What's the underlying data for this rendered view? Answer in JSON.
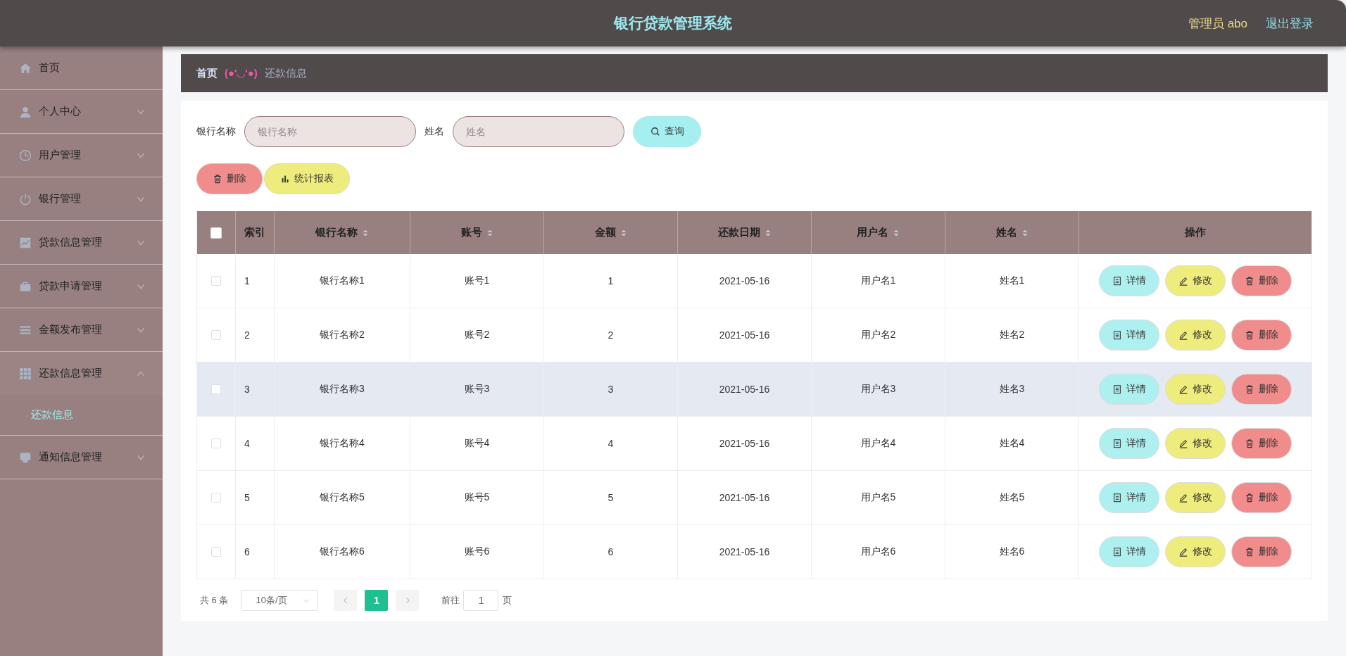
{
  "header": {
    "title": "银行贷款管理系统",
    "user": "管理员 abo",
    "logout": "退出登录"
  },
  "sidebar": {
    "items": [
      {
        "label": "首页"
      },
      {
        "label": "个人中心",
        "expanded": false
      },
      {
        "label": "用户管理",
        "expanded": false
      },
      {
        "label": "银行管理",
        "expanded": false
      },
      {
        "label": "贷款信息管理",
        "expanded": false
      },
      {
        "label": "贷款申请管理",
        "expanded": false
      },
      {
        "label": "金额发布管理",
        "expanded": false
      },
      {
        "label": "还款信息管理",
        "expanded": true,
        "children": [
          {
            "label": "还款信息",
            "selected": true
          }
        ]
      },
      {
        "label": "通知信息管理",
        "expanded": false
      }
    ]
  },
  "breadcrumb": {
    "home": "首页",
    "separator": "(●'◡'●)",
    "current": "还款信息"
  },
  "search": {
    "fields": [
      {
        "label": "银行名称",
        "placeholder": "银行名称"
      },
      {
        "label": "姓名",
        "placeholder": "姓名"
      }
    ],
    "button": "查询"
  },
  "actions": [
    {
      "kind": "delete",
      "label": "删除"
    },
    {
      "kind": "report",
      "label": "统计报表"
    }
  ],
  "table": {
    "select_all": {
      "checked": false
    },
    "columns": [
      {
        "label": "索引",
        "sortable": false
      },
      {
        "label": "银行名称",
        "sortable": true
      },
      {
        "label": "账号",
        "sortable": true
      },
      {
        "label": "金额",
        "sortable": true
      },
      {
        "label": "还款日期",
        "sortable": true
      },
      {
        "label": "用户名",
        "sortable": true
      },
      {
        "label": "姓名",
        "sortable": true
      },
      {
        "label": "操作",
        "sortable": false
      }
    ],
    "rows": [
      {
        "checked": false,
        "highlighted": false,
        "cells": [
          "1",
          "银行名称1",
          "账号1",
          "1",
          "2021-05-16",
          "用户名1",
          "姓名1"
        ],
        "buttons": [
          {
            "kind": "detail",
            "label": "详情"
          },
          {
            "kind": "edit",
            "label": "修改"
          },
          {
            "kind": "delete",
            "label": "删除"
          }
        ]
      },
      {
        "checked": false,
        "highlighted": false,
        "cells": [
          "2",
          "银行名称2",
          "账号2",
          "2",
          "2021-05-16",
          "用户名2",
          "姓名2"
        ],
        "buttons": [
          {
            "kind": "detail",
            "label": "详情"
          },
          {
            "kind": "edit",
            "label": "修改"
          },
          {
            "kind": "delete",
            "label": "删除"
          }
        ]
      },
      {
        "checked": false,
        "highlighted": true,
        "cells": [
          "3",
          "银行名称3",
          "账号3",
          "3",
          "2021-05-16",
          "用户名3",
          "姓名3"
        ],
        "buttons": [
          {
            "kind": "detail",
            "label": "详情"
          },
          {
            "kind": "edit",
            "label": "修改"
          },
          {
            "kind": "delete",
            "label": "删除"
          }
        ]
      },
      {
        "checked": false,
        "highlighted": false,
        "cells": [
          "4",
          "银行名称4",
          "账号4",
          "4",
          "2021-05-16",
          "用户名4",
          "姓名4"
        ],
        "buttons": [
          {
            "kind": "detail",
            "label": "详情"
          },
          {
            "kind": "edit",
            "label": "修改"
          },
          {
            "kind": "delete",
            "label": "删除"
          }
        ]
      },
      {
        "checked": false,
        "highlighted": false,
        "cells": [
          "5",
          "银行名称5",
          "账号5",
          "5",
          "2021-05-16",
          "用户名5",
          "姓名5"
        ],
        "buttons": [
          {
            "kind": "detail",
            "label": "详情"
          },
          {
            "kind": "edit",
            "label": "修改"
          },
          {
            "kind": "delete",
            "label": "删除"
          }
        ]
      },
      {
        "checked": false,
        "highlighted": false,
        "cells": [
          "6",
          "银行名称6",
          "账号6",
          "6",
          "2021-05-16",
          "用户名6",
          "姓名6"
        ],
        "buttons": [
          {
            "kind": "detail",
            "label": "详情"
          },
          {
            "kind": "edit",
            "label": "修改"
          },
          {
            "kind": "delete",
            "label": "删除"
          }
        ]
      }
    ]
  },
  "pagination": {
    "total": "共 6 条",
    "page_size": "10条/页",
    "pages": [
      {
        "label": "1",
        "selected": true
      }
    ],
    "goto_label": "前往",
    "goto_value": "1",
    "goto_suffix": "页"
  }
}
